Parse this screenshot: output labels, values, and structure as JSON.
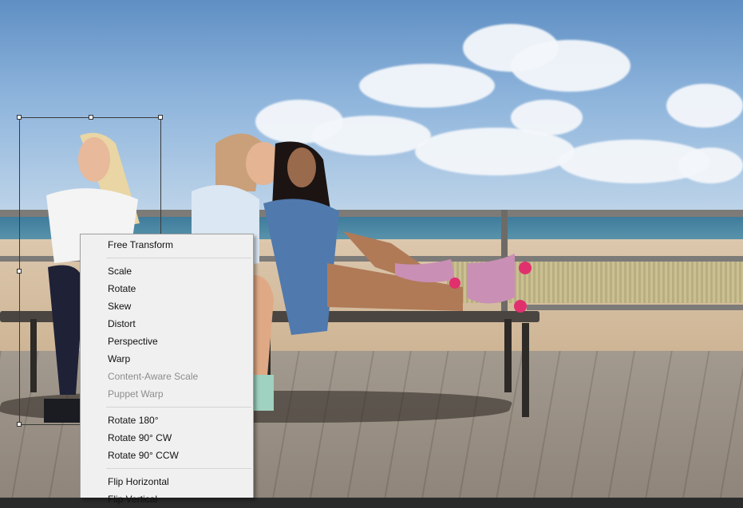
{
  "context_menu": {
    "items": [
      {
        "label": "Free Transform",
        "enabled": true
      },
      {
        "label": "Scale",
        "enabled": true
      },
      {
        "label": "Rotate",
        "enabled": true
      },
      {
        "label": "Skew",
        "enabled": true
      },
      {
        "label": "Distort",
        "enabled": true
      },
      {
        "label": "Perspective",
        "enabled": true
      },
      {
        "label": "Warp",
        "enabled": true
      },
      {
        "label": "Content-Aware Scale",
        "enabled": false
      },
      {
        "label": "Puppet Warp",
        "enabled": false
      },
      {
        "label": "Rotate 180°",
        "enabled": true
      },
      {
        "label": "Rotate 90° CW",
        "enabled": true
      },
      {
        "label": "Rotate 90° CCW",
        "enabled": true
      },
      {
        "label": "Flip Horizontal",
        "enabled": true
      },
      {
        "label": "Flip Vertical",
        "enabled": true
      }
    ]
  },
  "colors": {
    "menu_background": "#f0f0f0",
    "menu_text": "#111111",
    "menu_disabled_text": "#8d8d8d",
    "roller_skate_pink": "#c98fb4",
    "wheel_pink": "#e0306e"
  }
}
